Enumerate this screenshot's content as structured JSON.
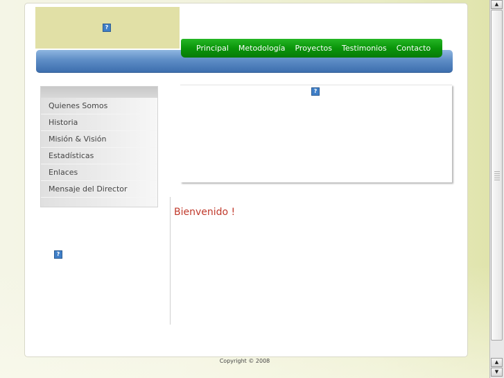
{
  "nav": {
    "items": [
      "Principal",
      "Metodología",
      "Proyectos",
      "Testimonios",
      "Contacto"
    ]
  },
  "sidebar": {
    "items": [
      "Quienes Somos",
      "Historia",
      "Misión & Visión",
      "Estadísticas",
      "Enlaces",
      "Mensaje del Director"
    ]
  },
  "main": {
    "welcome": "Bienvenido !"
  },
  "footer": {
    "copyright": "Copyright © 2008"
  },
  "icons": {
    "broken_image": "?"
  },
  "colors": {
    "nav_green": "#0a950a",
    "bar_blue": "#5e8dc6",
    "logo_bg": "#e1e0a6",
    "welcome_red": "#c0392b"
  }
}
